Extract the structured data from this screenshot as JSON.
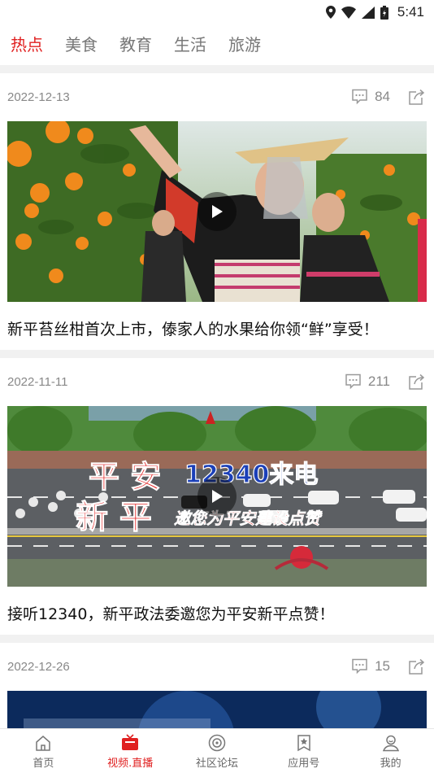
{
  "status_bar": {
    "time": "5:41"
  },
  "tabs": [
    {
      "label": "热点",
      "active": true
    },
    {
      "label": "美食",
      "active": false
    },
    {
      "label": "教育",
      "active": false
    },
    {
      "label": "生活",
      "active": false
    },
    {
      "label": "旅游",
      "active": false
    }
  ],
  "feed": [
    {
      "date": "2022-12-13",
      "comments": "84",
      "title": "新平苔丝柑首次上市，傣家人的水果给你领“鲜”享受！"
    },
    {
      "date": "2022-11-11",
      "comments": "211",
      "title": "接听12340，新平政法委邀您为平安新平点赞！",
      "overlay": {
        "line1a": "平 安",
        "line1b": "12340来电",
        "line2a": "新 平",
        "line2b": "邀您为平安建设点赞"
      }
    },
    {
      "date": "2022-12-26",
      "comments": "15",
      "title": ""
    }
  ],
  "bottom_nav": [
    {
      "label": "首页",
      "icon": "home-icon",
      "active": false
    },
    {
      "label": "视频.直播",
      "icon": "tv-icon",
      "active": true
    },
    {
      "label": "社区论坛",
      "icon": "forum-icon",
      "active": false
    },
    {
      "label": "应用号",
      "icon": "app-icon",
      "active": false
    },
    {
      "label": "我的",
      "icon": "user-icon",
      "active": false
    }
  ],
  "colors": {
    "accent": "#e02020",
    "muted": "#888888",
    "separator": "#f1f1f1"
  }
}
